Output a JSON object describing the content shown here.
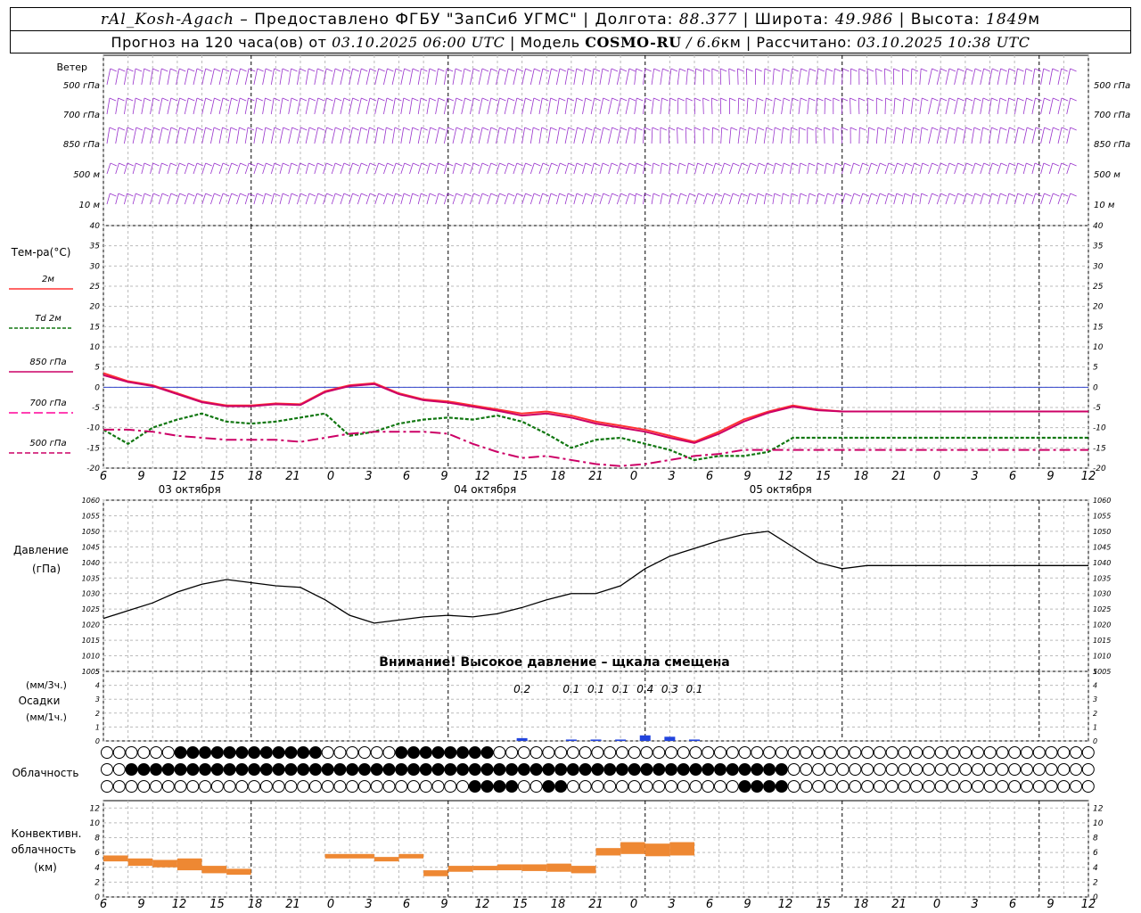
{
  "header": {
    "station": "rAl_Kosh-Agach",
    "provider": "– Предоставлено ФГБУ \"ЗапСиб УГМС\" |",
    "lon_label": "Долгота:",
    "lon": "88.377",
    "lat_label": "| Широта:",
    "lat": "49.986",
    "alt_label": "| Высота:",
    "alt": "1849",
    "alt_unit": "м",
    "forecast_label": "Прогноз на 120 часа(ов) от",
    "forecast_time": "03.10.2025 06:00 UTC",
    "model_label": "| Модель",
    "model": "COSMO-RU",
    "model_res": "/ 6.6",
    "model_res_unit": "км",
    "calc_label": "| Рассчитано:",
    "calc_time": "03.10.2025 10:38 UTC"
  },
  "wind_panel": {
    "title": "Ветер",
    "levels": [
      "500 гПа",
      "700 гПа",
      "850 гПа",
      "500 м",
      "10 м"
    ],
    "barb_color": "#9933cc"
  },
  "temp_panel": {
    "title": "Тем-ра(°С)",
    "legend": [
      {
        "label": "2м",
        "color": "#ff3333"
      },
      {
        "label": "Td  2м",
        "color": "#117711"
      },
      {
        "label": "850 гПа",
        "color": "#cc0066"
      },
      {
        "label": "700 гПа",
        "color": "#ff0099"
      },
      {
        "label": "500 гПа",
        "color": "#cc0066"
      }
    ]
  },
  "pressure_panel": {
    "title": "Давление",
    "unit": "(гПа)",
    "warning": "Внимание! Высокое давление – щкала смещена"
  },
  "precip_panel": {
    "unit3": "(мм/3ч.)",
    "title": "Осадки",
    "unit1": "(мм/1ч.)",
    "totals": [
      "0.2",
      "0.1",
      "0.1",
      "0.1",
      "0.4",
      "0.3",
      "0.1"
    ]
  },
  "cloud_panel": {
    "title": "Облачность"
  },
  "conv_panel": {
    "title1": "Конвективн.",
    "title2": "облачность",
    "title3": "(км)"
  },
  "time_axis": {
    "hour_labels": [
      "6",
      "9",
      "12",
      "15",
      "18",
      "21",
      "0",
      "3",
      "6",
      "9",
      "12",
      "15",
      "18",
      "21",
      "0",
      "3",
      "6",
      "9",
      "12",
      "15",
      "18",
      "21",
      "0",
      "3",
      "6",
      "9",
      "12"
    ],
    "date_labels": [
      "03 октября",
      "04 октября",
      "05 октября"
    ]
  },
  "chart_data": [
    {
      "type": "line",
      "title": "Тем-ра(°С)",
      "x_hours": [
        0,
        3,
        6,
        9,
        12,
        15,
        18,
        21,
        24,
        27,
        30,
        33,
        36,
        39,
        42,
        45,
        48,
        51,
        54,
        57,
        60,
        63,
        66,
        69,
        72,
        75,
        78,
        81,
        84,
        87,
        90,
        93,
        96,
        99,
        102,
        105,
        108,
        111,
        114,
        117,
        120
      ],
      "ylim": [
        -20,
        40
      ],
      "yticks": [
        -20,
        -15,
        -10,
        -5,
        0,
        5,
        10,
        15,
        20,
        25,
        30,
        35,
        40
      ],
      "series": [
        {
          "name": "2м",
          "color": "#ff3333",
          "values": [
            3.5,
            1.5,
            0.5,
            -1.5,
            -3.5,
            -4.5,
            -4.5,
            -4,
            -4.2,
            -1,
            0.5,
            1,
            -1.5,
            -3,
            -3.5,
            -4.5,
            -5.5,
            -6.5,
            -6,
            -7,
            -8.5,
            -9.5,
            -10.5,
            -12,
            -13.5,
            -11,
            -8,
            -6,
            -4.5,
            -5.5,
            -6,
            -6,
            -6,
            -6,
            -6,
            -6,
            -6,
            -6,
            -6,
            -6,
            -6
          ]
        },
        {
          "name": "850 гПа",
          "color": "#cc0066",
          "values": [
            3,
            1.3,
            0.3,
            -1.7,
            -3.7,
            -4.7,
            -4.7,
            -4.2,
            -4.4,
            -1.2,
            0.3,
            0.8,
            -1.7,
            -3.2,
            -3.8,
            -4.8,
            -5.8,
            -7,
            -6.5,
            -7.5,
            -9,
            -10,
            -11,
            -12.5,
            -13.8,
            -11.5,
            -8.5,
            -6.3,
            -4.8,
            -5.7,
            -6,
            -6,
            -6,
            -6,
            -6,
            -6,
            -6,
            -6,
            -6,
            -6,
            -6
          ]
        },
        {
          "name": "Td  2м",
          "color": "#117711",
          "values": [
            -10.5,
            -14,
            -10,
            -8,
            -6.5,
            -8.5,
            -9,
            -8.5,
            -7.5,
            -6.5,
            -12,
            -11,
            -9,
            -8,
            -7.5,
            -8,
            -7,
            -8.5,
            -11.5,
            -15,
            -13,
            -12.5,
            -14,
            -15.5,
            -18,
            -17,
            -17,
            -16,
            -12.5,
            -12.5,
            -12.5,
            -12.5,
            -12.5,
            -12.5,
            -12.5,
            -12.5,
            -12.5,
            -12.5,
            -12.5,
            -12.5,
            -12.5
          ]
        },
        {
          "name": "500 гПа",
          "color": "#cc0066",
          "values": [
            -10.5,
            -10.5,
            -11,
            -12,
            -12.5,
            -13,
            -13,
            -13,
            -13.5,
            -12.5,
            -11.5,
            -11,
            -11,
            -11,
            -11.5,
            -14,
            -16,
            -17.5,
            -17,
            -18,
            -19,
            -19.5,
            -19,
            -18,
            -17,
            -16.5,
            -15.5,
            -15.5,
            -15.5,
            -15.5,
            -15.5,
            -15.5,
            -15.5,
            -15.5,
            -15.5,
            -15.5,
            -15.5,
            -15.5,
            -15.5,
            -15.5,
            -15.5
          ]
        }
      ]
    },
    {
      "type": "line",
      "title": "Давление",
      "ylabel": "(гПа)",
      "ylim": [
        1005,
        1060
      ],
      "yticks": [
        1005,
        1010,
        1015,
        1020,
        1025,
        1030,
        1035,
        1040,
        1045,
        1050,
        1055,
        1060
      ],
      "x_hours": [
        0,
        3,
        6,
        9,
        12,
        15,
        18,
        21,
        24,
        27,
        30,
        33,
        36,
        39,
        42,
        45,
        48,
        51,
        54,
        57,
        60,
        63,
        66,
        69,
        72,
        75,
        78,
        81,
        84,
        87,
        90,
        93,
        96,
        99,
        102,
        105,
        108,
        111,
        114,
        117,
        120
      ],
      "values": [
        1022,
        1024.5,
        1027,
        1030.5,
        1033,
        1034.5,
        1033.5,
        1032.5,
        1032,
        1028,
        1023,
        1020.5,
        1021.5,
        1022.5,
        1023,
        1022.5,
        1023.5,
        1025.5,
        1028,
        1030,
        1030,
        1032.5,
        1038,
        1042,
        1044.5,
        1047,
        1049,
        1050,
        1045,
        1040,
        1038,
        1039,
        1039,
        1039,
        1039,
        1039,
        1039,
        1039,
        1039,
        1039,
        1039
      ]
    },
    {
      "type": "bar",
      "title": "Осадки",
      "ylim": [
        0,
        5
      ],
      "yticks": [
        0,
        1,
        2,
        3,
        4,
        5
      ],
      "x_hours": [
        51,
        57,
        60,
        63,
        66,
        69,
        72
      ],
      "values": [
        0.2,
        0.1,
        0.1,
        0.1,
        0.4,
        0.3,
        0.1
      ],
      "color": "#2244dd"
    },
    {
      "type": "bar",
      "title": "Конвективн. облачность",
      "ylabel": "(км)",
      "ylim": [
        0,
        13
      ],
      "yticks": [
        0,
        2,
        4,
        6,
        8,
        10,
        12
      ],
      "color": "#ee8833",
      "segments": [
        {
          "x0": 0,
          "x1": 3,
          "y0": 4.8,
          "y1": 5.6
        },
        {
          "x0": 3,
          "x1": 6,
          "y0": 4.2,
          "y1": 5.2
        },
        {
          "x0": 6,
          "x1": 9,
          "y0": 4.0,
          "y1": 5.0
        },
        {
          "x0": 9,
          "x1": 12,
          "y0": 3.6,
          "y1": 5.2
        },
        {
          "x0": 12,
          "x1": 15,
          "y0": 3.2,
          "y1": 4.2
        },
        {
          "x0": 15,
          "x1": 18,
          "y0": 3.0,
          "y1": 3.8
        },
        {
          "x0": 27,
          "x1": 33,
          "y0": 5.2,
          "y1": 5.8
        },
        {
          "x0": 33,
          "x1": 36,
          "y0": 4.8,
          "y1": 5.4
        },
        {
          "x0": 36,
          "x1": 39,
          "y0": 5.2,
          "y1": 5.8
        },
        {
          "x0": 39,
          "x1": 42,
          "y0": 2.8,
          "y1": 3.6
        },
        {
          "x0": 42,
          "x1": 45,
          "y0": 3.4,
          "y1": 4.2
        },
        {
          "x0": 45,
          "x1": 48,
          "y0": 3.6,
          "y1": 4.2
        },
        {
          "x0": 48,
          "x1": 51,
          "y0": 3.6,
          "y1": 4.4
        },
        {
          "x0": 51,
          "x1": 54,
          "y0": 3.5,
          "y1": 4.4
        },
        {
          "x0": 54,
          "x1": 57,
          "y0": 3.4,
          "y1": 4.5
        },
        {
          "x0": 57,
          "x1": 60,
          "y0": 3.2,
          "y1": 4.2
        },
        {
          "x0": 60,
          "x1": 63,
          "y0": 5.6,
          "y1": 6.6
        },
        {
          "x0": 63,
          "x1": 66,
          "y0": 5.8,
          "y1": 7.4
        },
        {
          "x0": 66,
          "x1": 69,
          "y0": 5.5,
          "y1": 7.2
        },
        {
          "x0": 69,
          "x1": 72,
          "y0": 5.6,
          "y1": 7.4
        }
      ]
    }
  ]
}
